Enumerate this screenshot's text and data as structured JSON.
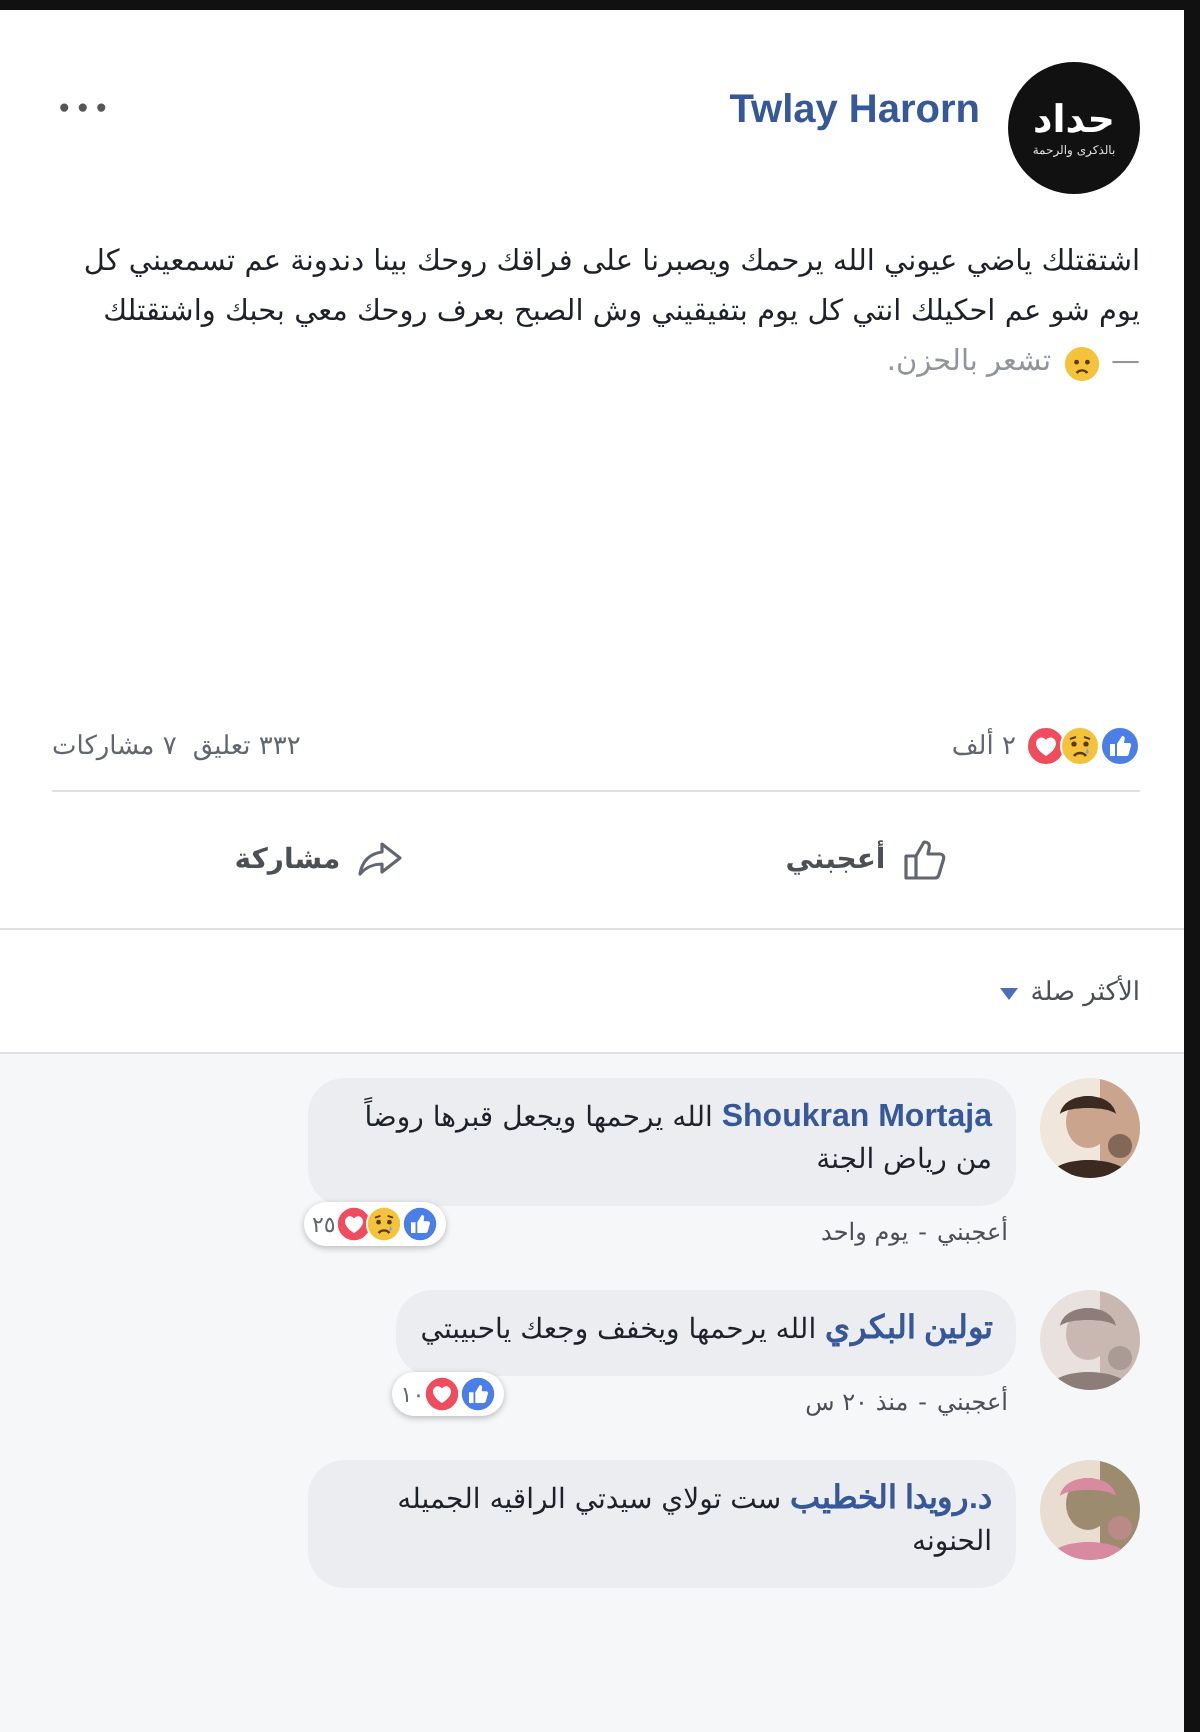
{
  "post": {
    "author": "Twlay Harorn",
    "page_logo": {
      "title": "حداد",
      "subtitle": "بالذكرى والرحمة"
    },
    "more": "•••",
    "text": "اشتقتلك ياضي عيوني الله يرحمك ويصبرنا على فراقك روحك بينا دندونة عم تسمعيني كل يوم شو عم احكيلك انتي كل يوم بتفيقيني وش الصبح بعرف روحك معي بحبك واشتقتلك",
    "feeling_separator": "—",
    "feeling": "تشعر بالحزن.",
    "reactions": [
      {
        "kind": "like"
      },
      {
        "kind": "sad"
      },
      {
        "kind": "love"
      }
    ],
    "reaction_count": "٢ ألف",
    "comments_count": "٣٣٢ تعليق",
    "shares_count": "٧ مشاركات",
    "actions": [
      {
        "kind": "like",
        "label": "أعجبني"
      },
      {
        "kind": "share",
        "label": "مشاركة"
      }
    ]
  },
  "sort": {
    "label": "الأكثر صلة"
  },
  "comments": [
    {
      "author": "Shoukran Mortaja",
      "text": "الله يرحمها ويجعل قبرها روضاً من رياض الجنة",
      "reactions": [
        {
          "kind": "like"
        },
        {
          "kind": "sad"
        },
        {
          "kind": "love"
        }
      ],
      "reaction_count": "٢٥",
      "like_label": "أعجبني",
      "separator": "-",
      "time": "يوم واحد"
    },
    {
      "author": "تولين البكري",
      "text": "الله يرحمها ويخفف وجعك ياحبيبتي",
      "reactions": [
        {
          "kind": "like"
        },
        {
          "kind": "love"
        }
      ],
      "reaction_count": "١٠",
      "like_label": "أعجبني",
      "separator": "-",
      "time": "منذ ٢٠ س"
    },
    {
      "author": "د.رويدا الخطيب",
      "text": "ست تولاي سيدتي الراقيه الجميله الحنونه"
    }
  ]
}
